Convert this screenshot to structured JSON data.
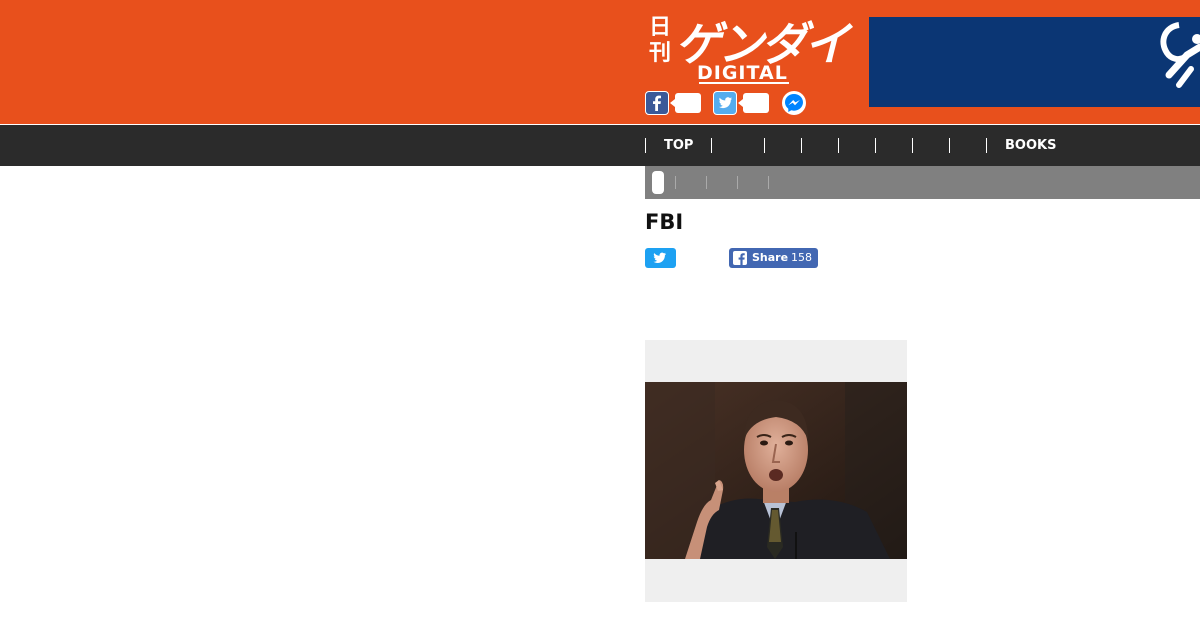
{
  "site": {
    "logo_kanji": "日刊",
    "logo_main": "ゲンダイ",
    "logo_sub": "DIGITAL",
    "brand_color": "#e8501c",
    "social_icons": [
      "facebook-icon",
      "twitter-icon",
      "messenger-icon"
    ]
  },
  "nav": {
    "items": [
      "TOP",
      "",
      "",
      "",
      "",
      "",
      "",
      "",
      "BOOKS"
    ],
    "bg_color": "#2b2b2b"
  },
  "breadcrumb": {
    "items": [
      "",
      "",
      "",
      "",
      ""
    ]
  },
  "article": {
    "title": "FBI",
    "share": {
      "facebook_label": "Share",
      "facebook_count": "158"
    }
  },
  "ad": {
    "bg_color": "#0b3674"
  }
}
